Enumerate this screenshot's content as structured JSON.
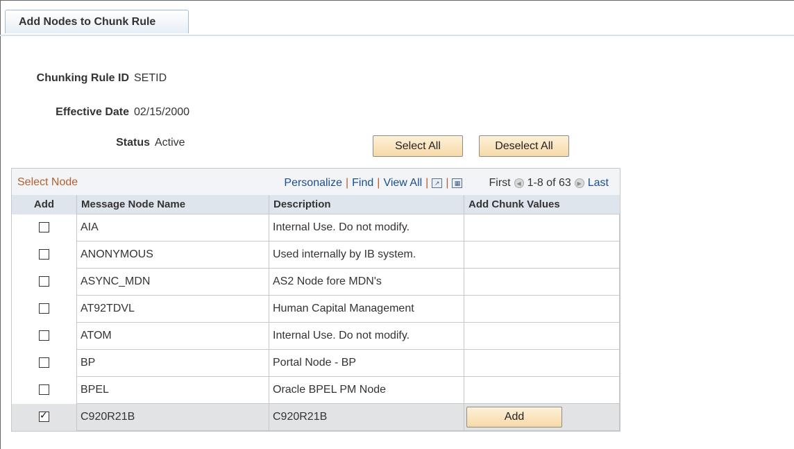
{
  "tab": {
    "label": "Add Nodes to Chunk Rule"
  },
  "fields": [
    {
      "label": "Chunking Rule ID",
      "value": "SETID"
    },
    {
      "label": "Effective Date",
      "value": "02/15/2000"
    },
    {
      "label": "Status",
      "value": "Active"
    }
  ],
  "buttons": {
    "select_all": "Select All",
    "deselect_all": "Deselect All"
  },
  "grid": {
    "title": "Select Node",
    "personalize": "Personalize",
    "find": "Find",
    "view_all": "View All",
    "first": "First",
    "range": "1-8 of 63",
    "last": "Last",
    "columns": [
      "Add",
      "Message Node Name",
      "Description",
      "Add Chunk Values"
    ],
    "add_button_label": "Add",
    "rows": [
      {
        "checked": false,
        "name": "AIA",
        "description": "Internal Use.  Do not modify."
      },
      {
        "checked": false,
        "name": "ANONYMOUS",
        "description": "Used internally by IB system."
      },
      {
        "checked": false,
        "name": "ASYNC_MDN",
        "description": "AS2 Node fore MDN's"
      },
      {
        "checked": false,
        "name": "AT92TDVL",
        "description": "Human Capital Management"
      },
      {
        "checked": false,
        "name": "ATOM",
        "description": "Internal Use.  Do not modify."
      },
      {
        "checked": false,
        "name": "BP",
        "description": "Portal Node - BP"
      },
      {
        "checked": false,
        "name": "BPEL",
        "description": "Oracle BPEL PM Node"
      },
      {
        "checked": true,
        "name": "C920R21B",
        "description": "C920R21B"
      }
    ]
  },
  "colors": {
    "button_bg": "#f7d9a8",
    "link": "#1c4e8d",
    "grid_title": "#b45f2b",
    "selected_row": "#e1e3e4"
  }
}
